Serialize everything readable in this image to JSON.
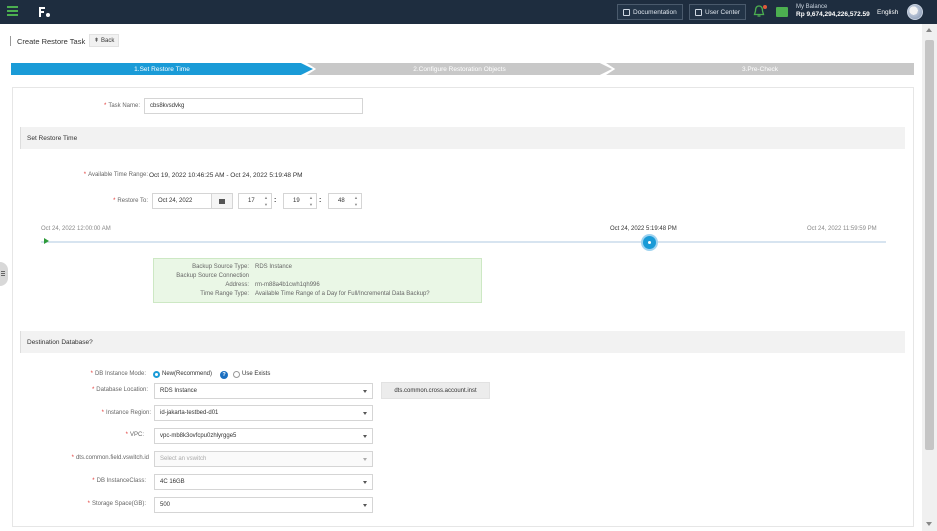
{
  "topbar": {
    "documentation": "Documentation",
    "user_center": "User Center",
    "balance_label": "My Balance",
    "balance_amount": "Rp 9,674,294,226,572.59",
    "language": "English"
  },
  "page": {
    "title": "Create Restore Task",
    "back": "Back"
  },
  "steps": [
    {
      "label": "1.Set Restore Time",
      "active": true
    },
    {
      "label": "2.Configure Restoration Objects",
      "active": false
    },
    {
      "label": "3.Pre-Check",
      "active": false
    }
  ],
  "task_name": {
    "label": "Task Name:",
    "value": "cbs8kvsdvkg"
  },
  "restore_section": {
    "title": "Set Restore Time",
    "range_label": "Available Time Range:",
    "range_value": "Oct 19, 2022 10:46:25 AM - Oct 24, 2022 5:19:48 PM",
    "restore_to_label": "Restore To:",
    "date": "Oct 24, 2022",
    "hour": "17",
    "minute": "19",
    "second": "48",
    "timeline_start": "Oct 24, 2022 12:00:00 AM",
    "timeline_current": "Oct 24, 2022 5:19:48 PM",
    "timeline_end": "Oct 24, 2022 11:59:59 PM",
    "timeline_current_fraction": 0.72
  },
  "backup_info": {
    "source_type_label": "Backup Source Type:",
    "source_type_value": "RDS Instance",
    "connection_label": "Backup Source Connection",
    "address_label": "Address:",
    "address_value": "rm-m88a4b1cwh1qh996",
    "range_type_label": "Time Range Type:",
    "range_type_value": "Available Time Range of a Day for Full/Incremental Data Backup?"
  },
  "destination": {
    "title": "Destination Database?",
    "mode_label": "DB Instance Mode:",
    "mode_new": "New(Recommend)",
    "mode_existing": "Use Exists",
    "location_label": "Database Location:",
    "location_value": "RDS Instance",
    "cross_account_button": "dts.common.cross.account.inst",
    "region_label": "Instance Region:",
    "region_value": "id-jakarta-testbed-d01",
    "vpc_label": "VPC:",
    "vpc_value": "vpc-mb8k3ovfcpu0zhlyrgge5",
    "vswitch_label": "dts.common.field.vswitch.id",
    "vswitch_placeholder": "Select an vswitch",
    "class_label": "DB InstanceClass:",
    "class_value": "4C 16GB",
    "storage_label": "Storage Space(GB):",
    "storage_value": "500"
  },
  "colors": {
    "topbar": "#1e2d3f",
    "accent": "#1a9bd7",
    "required": "#e0312e",
    "green": "#4caf50"
  }
}
